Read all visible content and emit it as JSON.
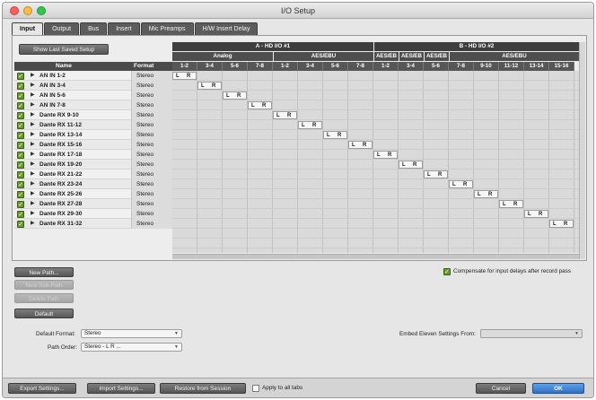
{
  "window": {
    "title": "I/O Setup"
  },
  "tabs": [
    {
      "label": "Input",
      "active": true
    },
    {
      "label": "Output",
      "active": false
    },
    {
      "label": "Bus",
      "active": false
    },
    {
      "label": "Insert",
      "active": false
    },
    {
      "label": "Mic Preamps",
      "active": false
    },
    {
      "label": "H/W Insert Delay",
      "active": false
    }
  ],
  "panel": {
    "show_last_saved_label": "Show Last Saved Setup",
    "columns": {
      "name": "Name",
      "format": "Format"
    },
    "interfaces": [
      {
        "label": "A - HD I/O #1",
        "groups": [
          {
            "label": "Analog",
            "channels": [
              "1-2",
              "3-4",
              "5-6",
              "7-8"
            ]
          },
          {
            "label": "AES/EBU",
            "channels": [
              "1-2",
              "3-4",
              "5-6",
              "7-8"
            ]
          }
        ]
      },
      {
        "label": "B - HD I/O #2",
        "groups": [
          {
            "label": "AES/EB",
            "channels": [
              "1-2"
            ]
          },
          {
            "label": "AES/EB",
            "channels": [
              "3-4"
            ]
          },
          {
            "label": "AES/EB",
            "channels": [
              "5-6"
            ]
          },
          {
            "label": "AES/EBU",
            "channels": [
              "7-8",
              "9-10",
              "11-12",
              "13-14",
              "15-16"
            ]
          }
        ]
      }
    ],
    "rows": [
      {
        "name": "AN IN 1-2",
        "format": "Stereo",
        "enabled": true
      },
      {
        "name": "AN IN 3-4",
        "format": "Stereo",
        "enabled": true
      },
      {
        "name": "AN IN 5-6",
        "format": "Stereo",
        "enabled": true
      },
      {
        "name": "AN IN 7-8",
        "format": "Stereo",
        "enabled": true
      },
      {
        "name": "Dante RX 9-10",
        "format": "Stereo",
        "enabled": true
      },
      {
        "name": "Dante RX 11-12",
        "format": "Stereo",
        "enabled": true
      },
      {
        "name": "Dante RX 13-14",
        "format": "Stereo",
        "enabled": true
      },
      {
        "name": "Dante RX 15-16",
        "format": "Stereo",
        "enabled": true
      },
      {
        "name": "Dante RX 17-18",
        "format": "Stereo",
        "enabled": true
      },
      {
        "name": "Dante RX 19-20",
        "format": "Stereo",
        "enabled": true
      },
      {
        "name": "Dante RX 21-22",
        "format": "Stereo",
        "enabled": true
      },
      {
        "name": "Dante RX 23-24",
        "format": "Stereo",
        "enabled": true
      },
      {
        "name": "Dante RX 25-26",
        "format": "Stereo",
        "enabled": true
      },
      {
        "name": "Dante RX 27-28",
        "format": "Stereo",
        "enabled": true
      },
      {
        "name": "Dante RX 29-30",
        "format": "Stereo",
        "enabled": true
      },
      {
        "name": "Dante RX 31-32",
        "format": "Stereo",
        "enabled": true
      }
    ],
    "assignment_labels": {
      "left": "L",
      "right": "R"
    }
  },
  "controls": {
    "new_path_label": "New Path...",
    "new_subpath_label": "New Sub-Path",
    "delete_path_label": "Delete Path",
    "default_label": "Default",
    "compensate_label": "Compensate for input delays after record pass",
    "compensate_checked": true,
    "default_format_label": "Default Format:",
    "default_format_value": "Stereo",
    "path_order_label": "Path Order:",
    "path_order_value": "Stereo - L R ...",
    "embed_label": "Embed Eleven Settings From:",
    "embed_value": ""
  },
  "footer": {
    "export_label": "Export Settings...",
    "import_label": "Import Settings...",
    "restore_label": "Restore from Session",
    "apply_all_label": "Apply to all tabs",
    "apply_all_checked": false,
    "cancel_label": "Cancel",
    "ok_label": "OK"
  },
  "colors": {
    "accent": "#2f72c6",
    "check_green": "#6a9a2e",
    "header_dark": "#3e3e3e"
  }
}
